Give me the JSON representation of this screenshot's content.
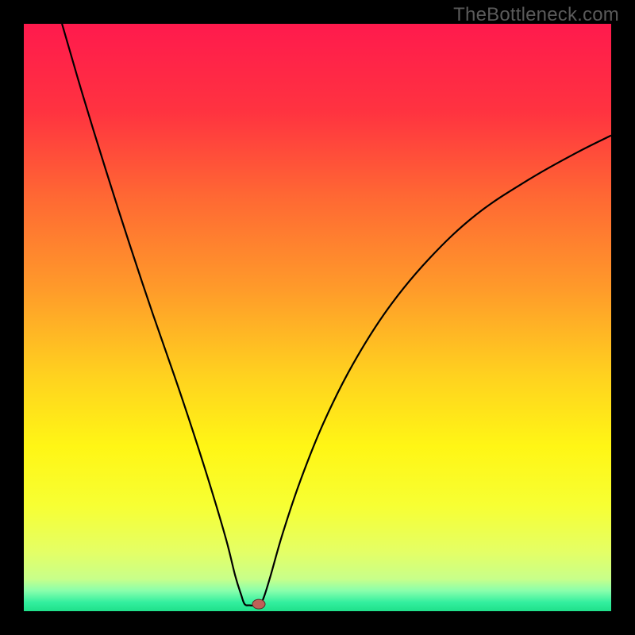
{
  "watermark": "TheBottleneck.com",
  "colors": {
    "curve_stroke": "#000000",
    "marker_fill": "#c06058",
    "marker_stroke": "#5a2d28",
    "frame_bg": "#000000"
  },
  "gradient_stops": [
    {
      "offset": 0.0,
      "color": "#ff1a4d"
    },
    {
      "offset": 0.15,
      "color": "#ff3340"
    },
    {
      "offset": 0.3,
      "color": "#ff6a33"
    },
    {
      "offset": 0.45,
      "color": "#ff9a2a"
    },
    {
      "offset": 0.6,
      "color": "#ffd21f"
    },
    {
      "offset": 0.72,
      "color": "#fff615"
    },
    {
      "offset": 0.82,
      "color": "#f7ff33"
    },
    {
      "offset": 0.9,
      "color": "#e4ff66"
    },
    {
      "offset": 0.945,
      "color": "#c8ff8a"
    },
    {
      "offset": 0.965,
      "color": "#8affac"
    },
    {
      "offset": 0.985,
      "color": "#33ef9f"
    },
    {
      "offset": 1.0,
      "color": "#1fe08a"
    }
  ],
  "chart_data": {
    "type": "line",
    "title": "",
    "xlabel": "",
    "ylabel": "",
    "xlim": [
      0,
      100
    ],
    "ylim": [
      0,
      100
    ],
    "optimum_x": 38.5,
    "curve": [
      {
        "x": 6.5,
        "y": 100.0
      },
      {
        "x": 10.0,
        "y": 88.0
      },
      {
        "x": 14.0,
        "y": 75.0
      },
      {
        "x": 18.0,
        "y": 62.5
      },
      {
        "x": 22.0,
        "y": 50.5
      },
      {
        "x": 26.0,
        "y": 39.0
      },
      {
        "x": 29.0,
        "y": 30.0
      },
      {
        "x": 32.0,
        "y": 20.5
      },
      {
        "x": 34.5,
        "y": 12.0
      },
      {
        "x": 36.0,
        "y": 6.0
      },
      {
        "x": 37.0,
        "y": 2.8
      },
      {
        "x": 37.6,
        "y": 1.2
      },
      {
        "x": 38.5,
        "y": 1.0
      },
      {
        "x": 40.0,
        "y": 1.0
      },
      {
        "x": 40.8,
        "y": 2.2
      },
      {
        "x": 42.0,
        "y": 6.0
      },
      {
        "x": 44.0,
        "y": 13.0
      },
      {
        "x": 47.0,
        "y": 22.0
      },
      {
        "x": 51.0,
        "y": 32.0
      },
      {
        "x": 56.0,
        "y": 42.0
      },
      {
        "x": 62.0,
        "y": 51.5
      },
      {
        "x": 69.0,
        "y": 60.0
      },
      {
        "x": 77.0,
        "y": 67.5
      },
      {
        "x": 86.0,
        "y": 73.5
      },
      {
        "x": 94.0,
        "y": 78.0
      },
      {
        "x": 100.0,
        "y": 81.0
      }
    ],
    "marker": {
      "x": 40.0,
      "y": 1.2
    }
  }
}
